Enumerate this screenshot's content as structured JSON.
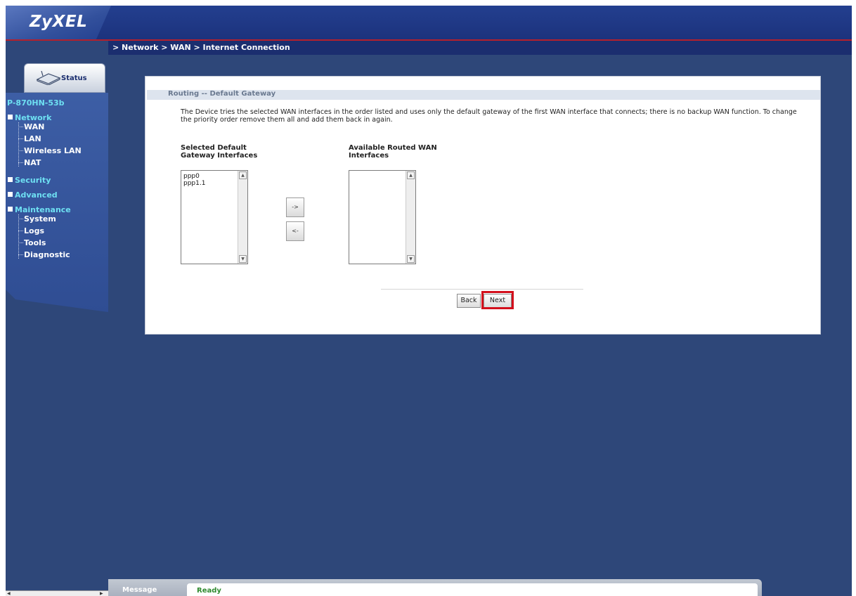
{
  "brand": {
    "logo_text": "ZyXEL",
    "colors": {
      "header": "#233f8f",
      "accent_line": "#b4202c",
      "nav_group": "#6ee0f2",
      "highlight": "#d3101c",
      "ready": "#2f8a2f"
    }
  },
  "breadcrumb": "> Network > WAN > Internet Connection",
  "sidebar": {
    "status_tab_label": "Status",
    "device_model": "P-870HN-53b",
    "groups": {
      "network": "Network",
      "security": "Security",
      "advanced": "Advanced",
      "maintenance": "Maintenance"
    },
    "network_items": [
      "WAN",
      "LAN",
      "Wireless LAN",
      "NAT"
    ],
    "maintenance_items": [
      "System",
      "Logs",
      "Tools",
      "Diagnostic"
    ]
  },
  "main": {
    "section_title": "Routing -- Default Gateway",
    "description": "The Device tries the selected WAN interfaces in the order listed and uses only the default gateway of the first WAN interface that connects; there is no backup WAN function. To change the priority order remove them all and add them back in again.",
    "selected_label_line1": "Selected Default",
    "selected_label_line2": "Gateway Interfaces",
    "available_label_line1": "Available Routed WAN",
    "available_label_line2": "Interfaces",
    "selected_interfaces": [
      "ppp0",
      "ppp1.1"
    ],
    "available_interfaces": [],
    "move_right_label": "->",
    "move_left_label": "<-",
    "back_label": "Back",
    "next_label": "Next"
  },
  "status_bar": {
    "message_label": "Message",
    "status_text": "Ready"
  },
  "icons": {
    "status_tab": "router-icon",
    "scroll_up": "scroll-up-arrow-icon",
    "scroll_down": "scroll-down-arrow-icon"
  }
}
